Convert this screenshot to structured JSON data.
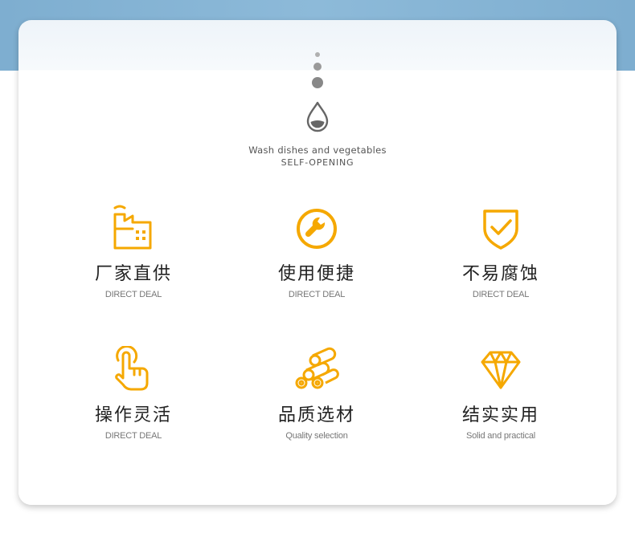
{
  "header": {
    "line1": "Wash dishes and vegetables",
    "line2": "SELF-OPENING",
    "icon": "water-drop-icon"
  },
  "colors": {
    "accent": "#f5a800",
    "band": "#8ab6d6",
    "icon_gray": "#666666"
  },
  "features": [
    {
      "title": "厂家直供",
      "subtitle": "DIRECT DEAL",
      "icon": "factory-icon"
    },
    {
      "title": "使用便捷",
      "subtitle": "DIRECT DEAL",
      "icon": "wrench-icon"
    },
    {
      "title": "不易腐蚀",
      "subtitle": "DIRECT DEAL",
      "icon": "shield-check-icon"
    },
    {
      "title": "操作灵活",
      "subtitle": "DIRECT DEAL",
      "icon": "hand-pointer-icon"
    },
    {
      "title": "品质选材",
      "subtitle": "Quality selection",
      "icon": "copper-pipes-icon"
    },
    {
      "title": "结实实用",
      "subtitle": "Solid and practical",
      "icon": "diamond-icon"
    }
  ]
}
